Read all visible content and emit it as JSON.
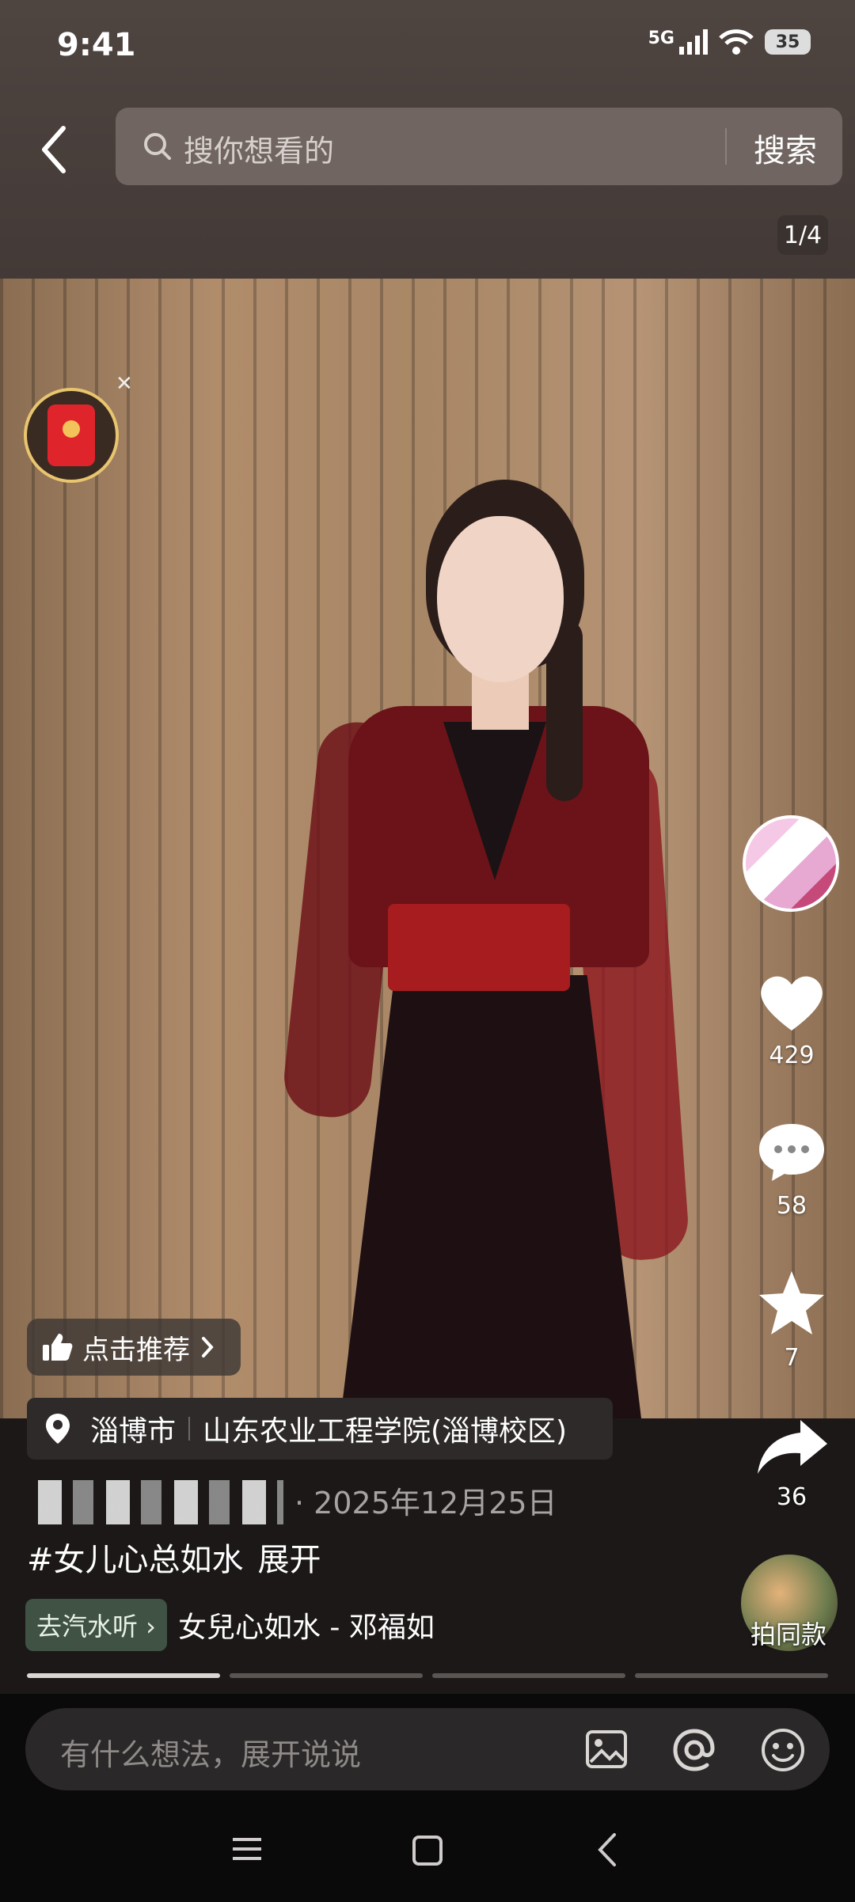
{
  "status_bar": {
    "time": "9:41",
    "network": "5G",
    "battery": "35"
  },
  "header": {
    "search_placeholder": "搜你想看的",
    "search_button": "搜索",
    "page_indicator": "1/4"
  },
  "actions": {
    "likes": "429",
    "comments": "58",
    "favorites": "7",
    "shares": "36"
  },
  "recommend_label": "点击推荐",
  "location": {
    "city": "淄博市",
    "place": "山东农业工程学院(淄博校区)"
  },
  "post": {
    "date": "· 2025年12月25日",
    "hashtag": "#女儿心总如水",
    "expand": "展开"
  },
  "music": {
    "tag": "去汽水听 ›",
    "title": "女兒心如水 - 邓福如",
    "same_style": "拍同款"
  },
  "progress": {
    "total": 4,
    "current": 1
  },
  "comment_bar": {
    "placeholder": "有什么想法，展开说说"
  },
  "colors": {
    "like": "#ffffff",
    "accent_red": "#ff2c55",
    "music_tag_bg": "#3f5244"
  },
  "icons": [
    "back-icon",
    "search-icon",
    "red-packet-icon",
    "close-icon",
    "heart-icon",
    "comment-icon",
    "star-icon",
    "share-icon",
    "thumb-up-icon",
    "chevron-right-icon",
    "location-pin-icon",
    "image-icon",
    "at-icon",
    "emoji-icon",
    "menu-icon",
    "home-icon",
    "nav-back-icon"
  ]
}
